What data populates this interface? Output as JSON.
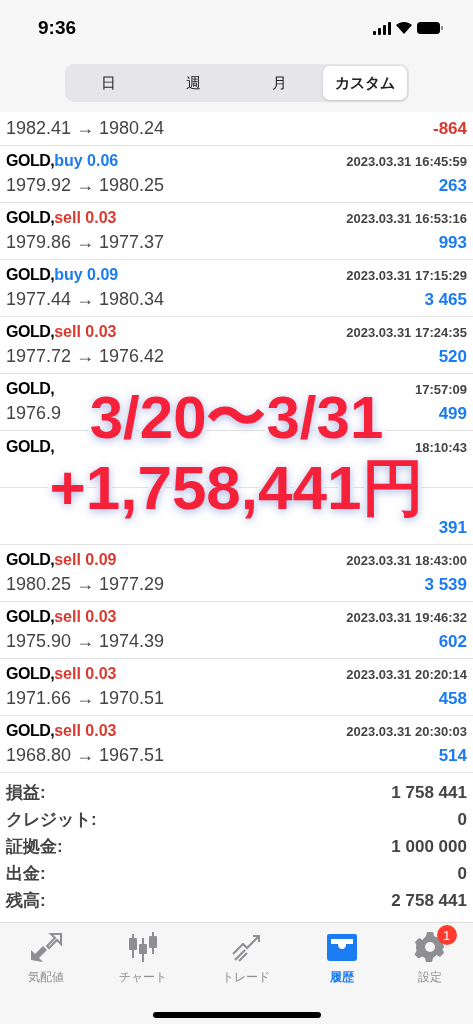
{
  "status_bar": {
    "time": "9:36"
  },
  "period_tabs": [
    {
      "label": "日",
      "selected": false
    },
    {
      "label": "週",
      "selected": false
    },
    {
      "label": "月",
      "selected": false
    },
    {
      "label": "カスタム",
      "selected": true
    }
  ],
  "first_row": {
    "prices": "1982.41 → 1980.24",
    "profit": "-864",
    "negative": true
  },
  "deals": [
    {
      "symbol": "GOLD,",
      "side": "buy 0.06",
      "kind": "buy",
      "time": "2023.03.31 16:45:59",
      "prices": "1979.92 → 1980.25",
      "profit": "263",
      "negative": false
    },
    {
      "symbol": "GOLD,",
      "side": "sell 0.03",
      "kind": "sell",
      "time": "2023.03.31 16:53:16",
      "prices": "1979.86 → 1977.37",
      "profit": "993",
      "negative": false
    },
    {
      "symbol": "GOLD,",
      "side": "buy 0.09",
      "kind": "buy",
      "time": "2023.03.31 17:15:29",
      "prices": "1977.44 → 1980.34",
      "profit": "3 465",
      "negative": false
    },
    {
      "symbol": "GOLD,",
      "side": "sell 0.03",
      "kind": "sell",
      "time": "2023.03.31 17:24:35",
      "prices": "1977.72 → 1976.42",
      "profit": "520",
      "negative": false
    },
    {
      "symbol": "GOLD,",
      "time": "17:57:09",
      "prices": "1976.9",
      "profit": "499",
      "negative": false
    },
    {
      "symbol": "GOLD,",
      "time": "18:10:43"
    },
    {
      "profit": "391",
      "negative": false
    },
    {
      "symbol": "GOLD,",
      "side": "sell 0.09",
      "kind": "sell",
      "time": "2023.03.31 18:43:00",
      "prices": "1980.25 → 1977.29",
      "profit": "3 539",
      "negative": false
    },
    {
      "symbol": "GOLD,",
      "side": "sell 0.03",
      "kind": "sell",
      "time": "2023.03.31 19:46:32",
      "prices": "1975.90 → 1974.39",
      "profit": "602",
      "negative": false
    },
    {
      "symbol": "GOLD,",
      "side": "sell 0.03",
      "kind": "sell",
      "time": "2023.03.31 20:20:14",
      "prices": "1971.66 → 1970.51",
      "profit": "458",
      "negative": false
    },
    {
      "symbol": "GOLD,",
      "side": "sell 0.03",
      "kind": "sell",
      "time": "2023.03.31 20:30:03",
      "prices": "1968.80 → 1967.51",
      "profit": "514",
      "negative": false
    }
  ],
  "summary": [
    {
      "label": "損益:",
      "value": "1 758 441"
    },
    {
      "label": "クレジット:",
      "value": "0"
    },
    {
      "label": "証拠金:",
      "value": "1 000 000"
    },
    {
      "label": "出金:",
      "value": "0"
    },
    {
      "label": "残高:",
      "value": "2 758 441"
    }
  ],
  "overlay": {
    "period": "3/20〜3/31",
    "total": "+1,758,441円"
  },
  "tab_bar": [
    {
      "label": "気配値",
      "kind": "quotes",
      "selected": false
    },
    {
      "label": "チャート",
      "kind": "chart",
      "selected": false
    },
    {
      "label": "トレード",
      "kind": "trade",
      "selected": false
    },
    {
      "label": "履歴",
      "kind": "history",
      "selected": true
    },
    {
      "label": "設定",
      "kind": "settings",
      "selected": false,
      "badge": "1"
    }
  ]
}
